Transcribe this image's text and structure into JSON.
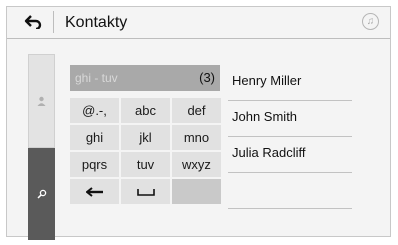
{
  "header": {
    "title": "Kontakty",
    "back_icon": "back-arrow-icon",
    "music_icon": "music-note-icon"
  },
  "side_rail": {
    "items": [
      {
        "icon": "person-icon",
        "state": "inactive"
      },
      {
        "icon": "search-icon",
        "state": "active"
      }
    ]
  },
  "search": {
    "query": "ghi - tuv",
    "count": "(3)"
  },
  "keypad": {
    "keys": [
      "@.-,",
      "abc",
      "def",
      "ghi",
      "jkl",
      "mno",
      "pqrs",
      "tuv",
      "wxyz",
      "←",
      "␣",
      ""
    ],
    "icons": {
      "backspace": "backspace-icon",
      "space": "space-icon"
    }
  },
  "contacts": {
    "items": [
      {
        "name": "Henry Miller"
      },
      {
        "name": "John Smith"
      },
      {
        "name": "Julia Radcliff"
      },
      {
        "name": ""
      }
    ]
  },
  "colors": {
    "background": "#f4f4f4",
    "key": "#e1e1e1",
    "search_field": "#a9a9a9",
    "active_rail": "#5a5a5a"
  }
}
